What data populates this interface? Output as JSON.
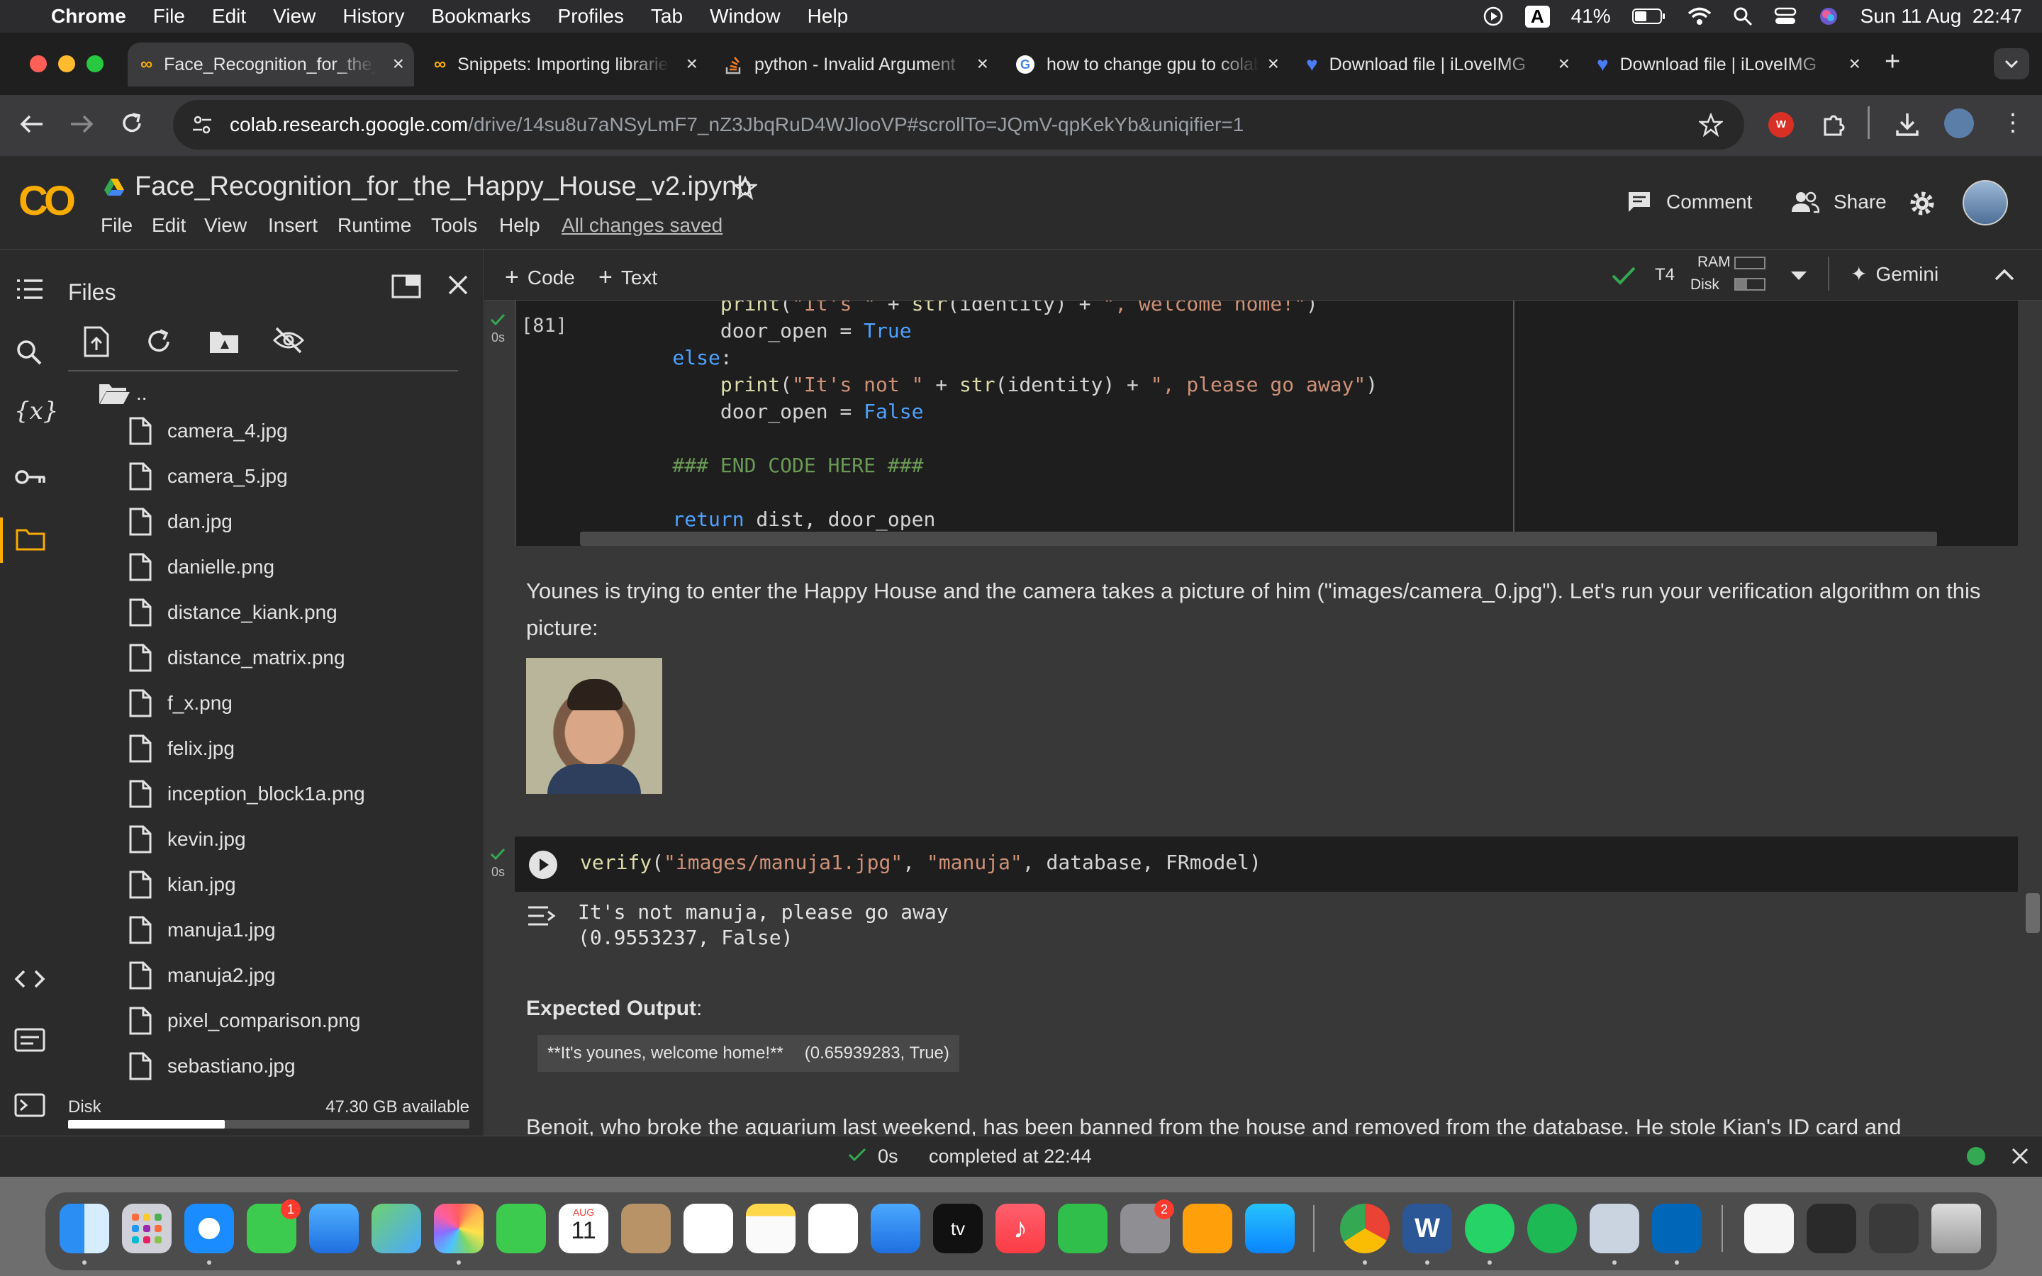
{
  "menubar": {
    "app": "Chrome",
    "items": [
      "File",
      "Edit",
      "View",
      "History",
      "Bookmarks",
      "Profiles",
      "Tab",
      "Window",
      "Help"
    ],
    "battery": "41%",
    "datetime": "Sun 11 Aug  22:47",
    "input_badge": "A"
  },
  "tabs": [
    {
      "title": "Face_Recognition_for_the_Happy_House",
      "icon": "colab-icon",
      "active": true
    },
    {
      "title": "Snippets: Importing libraries",
      "icon": "colab-icon",
      "active": false
    },
    {
      "title": "python - Invalid Argument",
      "icon": "stackoverflow-icon",
      "active": false
    },
    {
      "title": "how to change gpu to colab",
      "icon": "google-icon",
      "active": false
    },
    {
      "title": "Download file | iLoveIMG",
      "icon": "heart-icon",
      "active": false
    },
    {
      "title": "Download file | iLoveIMG",
      "icon": "heart-icon",
      "active": false
    }
  ],
  "address": {
    "host": "colab.research.google.com",
    "path": "/drive/14su8u7aNSyLmF7_nZ3JbqRuD4WJlooVP#scrollTo=JQmV-qpKekYb&uniqifier=1"
  },
  "colab": {
    "logo": "CO",
    "notebook_title": "Face_Recognition_for_the_Happy_House_v2.ipynb",
    "menu": [
      "File",
      "Edit",
      "View",
      "Insert",
      "Runtime",
      "Tools",
      "Help"
    ],
    "saved_status": "All changes saved",
    "comment_label": "Comment",
    "share_label": "Share"
  },
  "files_panel": {
    "title": "Files",
    "parent_dir": "..",
    "files": [
      "camera_4.jpg",
      "camera_5.jpg",
      "dan.jpg",
      "danielle.png",
      "distance_kiank.png",
      "distance_matrix.png",
      "f_x.png",
      "felix.jpg",
      "inception_block1a.png",
      "kevin.jpg",
      "kian.jpg",
      "manuja1.jpg",
      "manuja2.jpg",
      "pixel_comparison.png",
      "sebastiano.jpg"
    ],
    "disk_label": "Disk",
    "disk_available": "47.30 GB available",
    "disk_used_fraction": 0.39
  },
  "nbtoolbar": {
    "code_label": "Code",
    "text_label": "Text",
    "runtime": "T4",
    "ram_label": "RAM",
    "disk_label": "Disk",
    "gemini_label": "Gemini"
  },
  "cell1": {
    "exec_count": "[81]",
    "time": "0s"
  },
  "markdown1": {
    "text": "Younes is trying to enter the Happy House and the camera takes a picture of him (\"images/camera_0.jpg\"). Let's run your verification algorithm on this picture:"
  },
  "cell2": {
    "time": "0s",
    "output_line1": "It's not manuja, please go away",
    "output_line2": "(0.9553237, False)"
  },
  "expected": {
    "heading": "Expected Output",
    "colon": ":",
    "col1": "**It's younes, welcome home!**",
    "col2": "(0.65939283, True)"
  },
  "markdown2": {
    "text": "Benoit, who broke the aquarium last weekend, has been banned from the house and removed from the database. He stole Kian's ID card and"
  },
  "statusbar": {
    "duration": "0s",
    "completed": "completed at 22:44"
  },
  "dock": {
    "calendar_month": "AUG",
    "calendar_day": "11",
    "messages_badge": "1",
    "settings_badge": "2",
    "tv_label": "tv"
  }
}
